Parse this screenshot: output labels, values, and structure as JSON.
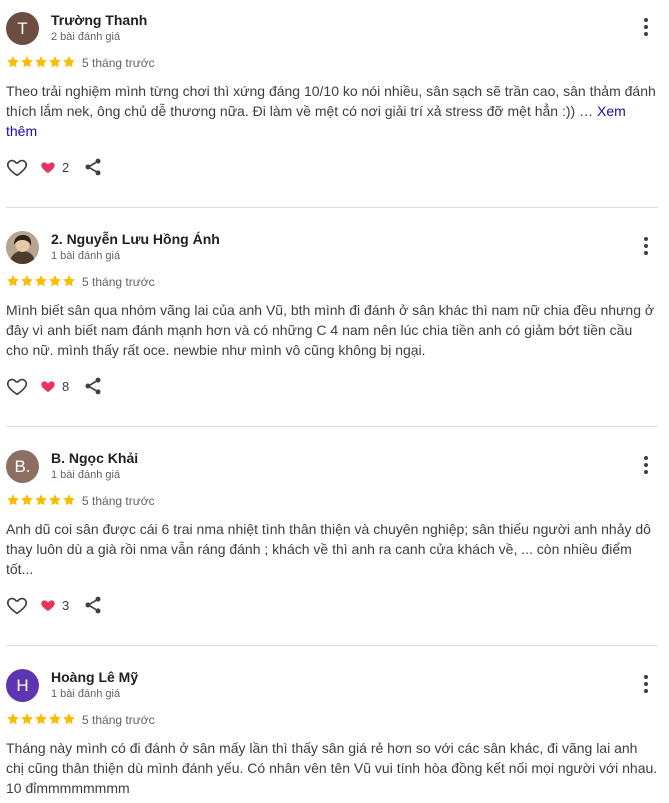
{
  "colors": {
    "star": "#fbbc04",
    "heart": "#e8335e",
    "link": "#1a0dab"
  },
  "reviews": [
    {
      "avatar_letter": "T",
      "avatar_color": "#6d4c41",
      "avatar_is_photo": false,
      "name": "Trường Thanh",
      "count": "2 bài đánh giá",
      "rating": 5,
      "time": "5 tháng trước",
      "text": "Theo trải nghiệm mình từng chơi thì xứng đáng 10/10 ko nói nhiều, sân sạch sẽ trần cao, sân thảm đánh thích lắm nek, ông chủ dễ thương nữa. Đi làm về mệt có nơi giải trí xả stress đỡ mệt hẳn :)) … ",
      "see_more": "Xem thêm",
      "reactions": "2"
    },
    {
      "avatar_letter": "",
      "avatar_color": "#8d7b68",
      "avatar_is_photo": true,
      "name": "2. Nguyễn Lưu Hồng Ánh",
      "count": "1 bài đánh giá",
      "rating": 5,
      "time": "5 tháng trước",
      "text": "Mình biết sân qua nhóm vãng lai của anh Vũ, bth mình đi đánh ở sân khác thì nam nữ chia đều nhưng ở đây vì anh biết nam đánh mạnh hơn và có những C 4 nam nên lúc chia tiền anh có giảm bớt tiền cầu cho nữ. mình thấy rất oce. newbie như mình vô cũng không bị ngại.",
      "see_more": "",
      "reactions": "8"
    },
    {
      "avatar_letter": "B.",
      "avatar_color": "#8d6e63",
      "avatar_is_photo": false,
      "name": "B. Ngọc Khải",
      "count": "1 bài đánh giá",
      "rating": 5,
      "time": "5 tháng trước",
      "text": "Anh dũ coi sân được cái 6 trai nma nhiệt tình thân thiện và chuyên nghiệp; sân thiếu người anh nhảy dô thay luôn dù a già rồi nma vẫn ráng đánh ; khách về thì anh ra canh cửa khách về, ... còn nhiều điểm tốt...",
      "see_more": "",
      "reactions": "3"
    },
    {
      "avatar_letter": "H",
      "avatar_color": "#5e35b1",
      "avatar_is_photo": false,
      "name": "Hoàng Lê Mỹ",
      "count": "1 bài đánh giá",
      "rating": 5,
      "time": "5 tháng trước",
      "text": "Tháng này mình có đi đánh ở sân mấy lần thì thấy sân giá rẻ hơn so với các sân khác, đi vãng lai anh chị cũng thân thiện dù mình đánh yếu. Có nhân vên tên Vũ vui tính hòa đồng kết nối mọi người với nhau. 10 đỉmmmmmmmm",
      "see_more": "",
      "reactions": ""
    }
  ]
}
